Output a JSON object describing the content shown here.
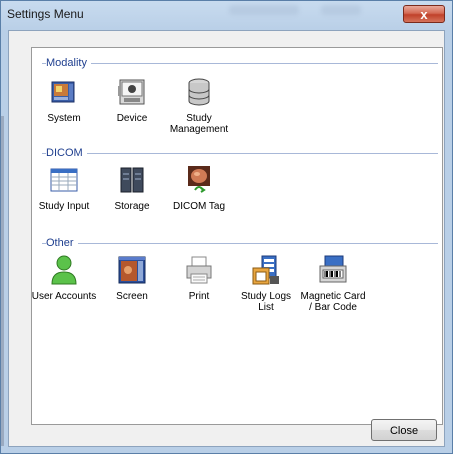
{
  "window": {
    "title": "Settings Menu",
    "close_glyph": "x"
  },
  "groups": [
    {
      "title": "Modality",
      "items": [
        {
          "label": "System",
          "icon": "system-icon"
        },
        {
          "label": "Device",
          "icon": "device-icon"
        },
        {
          "label": "Study\nManagement",
          "icon": "database-icon"
        }
      ]
    },
    {
      "title": "DICOM",
      "items": [
        {
          "label": "Study Input",
          "icon": "table-icon"
        },
        {
          "label": "Storage",
          "icon": "server-icon"
        },
        {
          "label": "DICOM Tag",
          "icon": "image-tag-icon"
        }
      ]
    },
    {
      "title": "Other",
      "items": [
        {
          "label": "User Accounts",
          "icon": "user-icon"
        },
        {
          "label": "Screen",
          "icon": "screen-icon"
        },
        {
          "label": "Print",
          "icon": "printer-icon"
        },
        {
          "label": "Study Logs\nList",
          "icon": "logs-icon"
        },
        {
          "label": "Magnetic Card\n/ Bar Code",
          "icon": "card-reader-icon"
        }
      ]
    }
  ],
  "footer": {
    "close_label": "Close"
  }
}
